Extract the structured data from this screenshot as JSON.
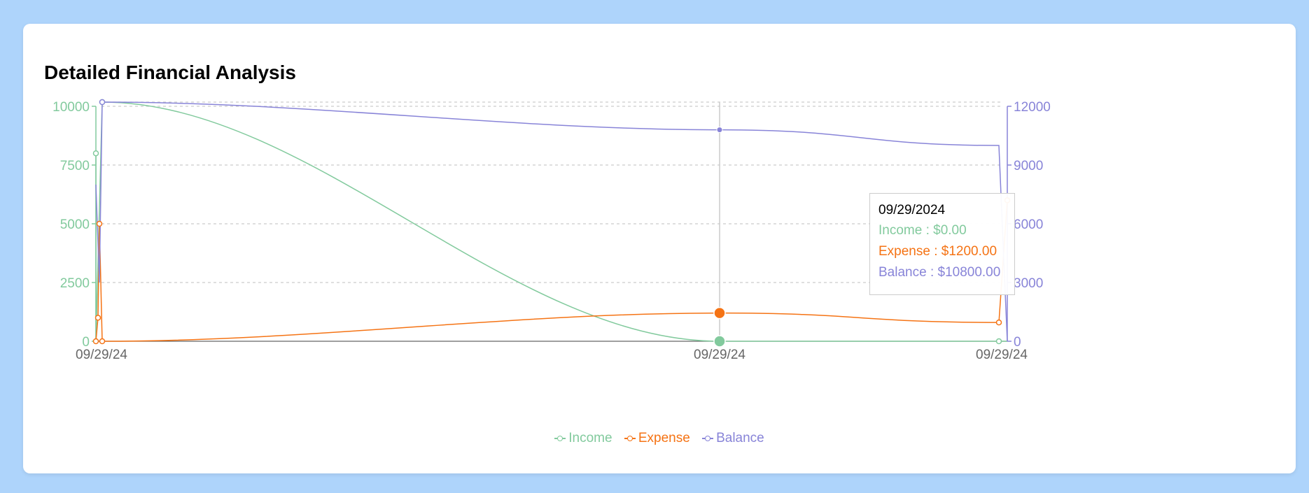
{
  "title": "Detailed Financial Analysis",
  "colors": {
    "income": "#82ca9d",
    "expense": "#f57314",
    "balance": "#8884d8",
    "background": "#aed4fb",
    "card": "#ffffff"
  },
  "chart_data": {
    "type": "line",
    "title": "Detailed Financial Analysis",
    "x_tick_labels": [
      "09/29/24",
      "09/29/24",
      "09/29/24"
    ],
    "y_left": {
      "ticks": [
        0,
        2500,
        5000,
        7500,
        10000
      ],
      "range": [
        0,
        10000
      ]
    },
    "y_right": {
      "ticks": [
        0,
        3000,
        6000,
        9000,
        12000
      ],
      "range": [
        0,
        12000
      ]
    },
    "grid": "dashed horizontal",
    "legend_position": "bottom-center",
    "series": [
      {
        "name": "Income",
        "axis": "left",
        "values": [
          0,
          8000,
          0,
          10000,
          0,
          0
        ]
      },
      {
        "name": "Expense",
        "axis": "left",
        "values": [
          0,
          1000,
          5000,
          0,
          1200,
          800,
          6000
        ]
      },
      {
        "name": "Balance",
        "axis": "right",
        "values": [
          8000,
          7000,
          3000,
          12000,
          10800,
          10000,
          0
        ]
      }
    ],
    "highlighted_point": {
      "date": "09/29/2024",
      "income": 0,
      "expense": 1200,
      "balance": 10800
    }
  },
  "tooltip": {
    "date": "09/29/2024",
    "income": "Income : $0.00",
    "expense": "Expense : $1200.00",
    "balance": "Balance : $10800.00"
  },
  "legend": [
    {
      "label": "Income",
      "color": "#82ca9d"
    },
    {
      "label": "Expense",
      "color": "#f57314"
    },
    {
      "label": "Balance",
      "color": "#8884d8"
    }
  ]
}
